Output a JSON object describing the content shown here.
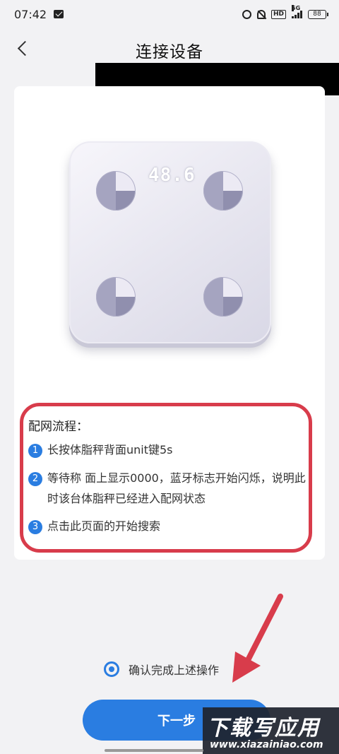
{
  "status_bar": {
    "time": "07:42",
    "battery": "88",
    "network": "5G",
    "hd": "HD"
  },
  "header": {
    "title": "连接设备"
  },
  "device": {
    "display_value": "48.6"
  },
  "steps": {
    "title": "配网流程：",
    "items": [
      {
        "num": "1",
        "text": "长按体脂秤背面unit键5s"
      },
      {
        "num": "2",
        "text": "等待称 面上显示0000，蓝牙标志开始闪烁，说明此时该台体脂秤已经进入配网状态"
      },
      {
        "num": "3",
        "text": "点击此页面的开始搜索"
      }
    ]
  },
  "confirm": {
    "label": "确认完成上述操作",
    "checked": true
  },
  "next_button": {
    "label": "下一步"
  },
  "watermark": {
    "title": "下载写应用",
    "site": "www.xiazainiao.com"
  },
  "colors": {
    "accent": "#2a7de1",
    "highlight": "#d83c4b"
  }
}
